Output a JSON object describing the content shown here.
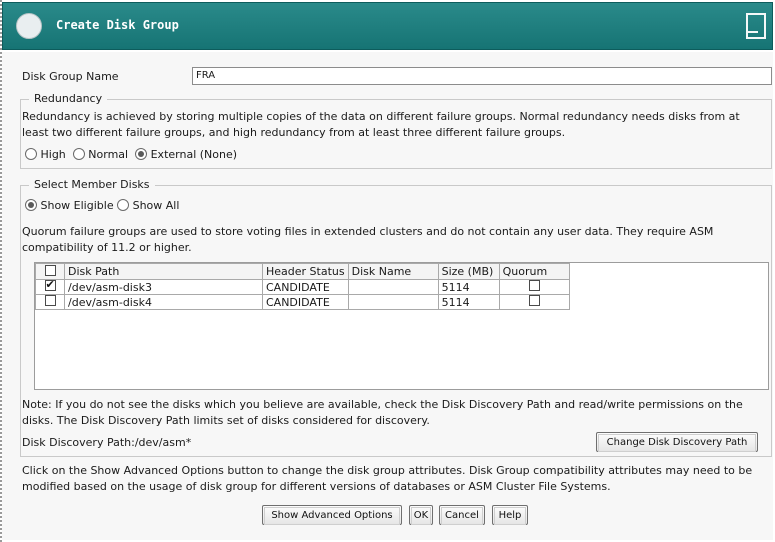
{
  "window": {
    "title": "Create Disk Group"
  },
  "disk_group_name": {
    "label": "Disk Group Name",
    "value": "FRA"
  },
  "redundancy": {
    "legend": "Redundancy",
    "description": "Redundancy is achieved by storing multiple copies of the data on different failure groups. Normal redundancy needs disks from at least two different failure groups, and high redundancy from at least three different failure groups.",
    "options": [
      {
        "label": "High",
        "selected": false
      },
      {
        "label": "Normal",
        "selected": false
      },
      {
        "label": "External (None)",
        "selected": true
      }
    ]
  },
  "member_disks": {
    "legend": "Select Member Disks",
    "filter_options": [
      {
        "label": "Show Eligible",
        "selected": true
      },
      {
        "label": "Show All",
        "selected": false
      }
    ],
    "quorum_note": "Quorum failure groups are used to store voting files in extended clusters and do not contain any user data. They require ASM compatibility of 11.2 or higher.",
    "table": {
      "columns": [
        "Disk Path",
        "Header Status",
        "Disk Name",
        "Size (MB)",
        "Quorum"
      ],
      "rows": [
        {
          "selected": true,
          "disk_path": "/dev/asm-disk3",
          "header_status": "CANDIDATE",
          "disk_name": "",
          "size_mb": "5114",
          "quorum": false
        },
        {
          "selected": false,
          "disk_path": "/dev/asm-disk4",
          "header_status": "CANDIDATE",
          "disk_name": "",
          "size_mb": "5114",
          "quorum": false
        }
      ]
    },
    "discovery_note": "Note: If you do not see the disks which you believe are available, check the Disk Discovery Path and read/write permissions on the disks. The Disk Discovery Path limits set of disks considered for discovery.",
    "discovery_path_label": "Disk Discovery Path:/dev/asm*",
    "change_path_button": "Change Disk Discovery Path"
  },
  "advanced_note": "Click on the Show Advanced Options button to change the disk group attributes. Disk Group compatibility attributes may need to be modified based on the usage of disk group for different versions of databases or ASM Cluster File Systems.",
  "buttons": {
    "advanced": "Show Advanced Options",
    "ok": "OK",
    "cancel": "Cancel",
    "help": "Help"
  },
  "colors": {
    "titlebar": "#1a7b7b",
    "background": "#f7f7f7"
  }
}
